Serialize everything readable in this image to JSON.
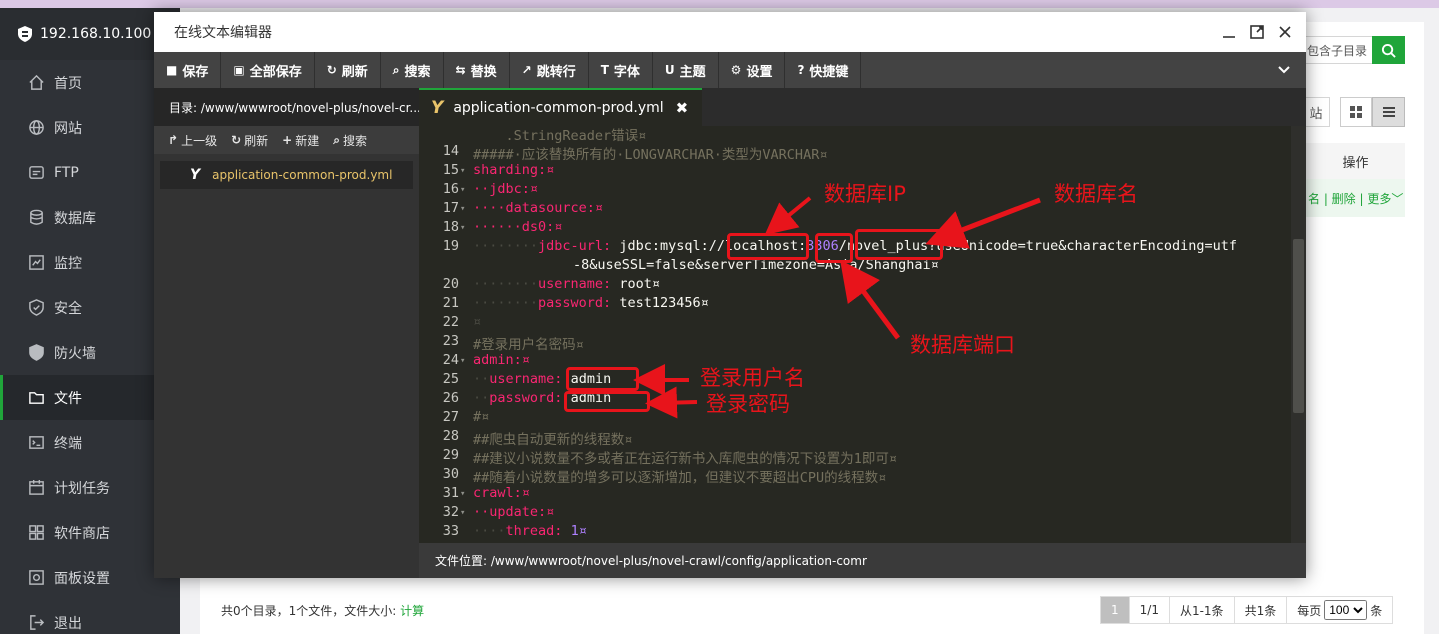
{
  "sidebar": {
    "host": "192.168.10.100",
    "items": [
      {
        "label": "首页",
        "icon": "home-icon"
      },
      {
        "label": "网站",
        "icon": "globe-icon"
      },
      {
        "label": "FTP",
        "icon": "ftp-icon"
      },
      {
        "label": "数据库",
        "icon": "database-icon"
      },
      {
        "label": "监控",
        "icon": "monitor-icon"
      },
      {
        "label": "安全",
        "icon": "shield-icon"
      },
      {
        "label": "防火墙",
        "icon": "firewall-icon"
      },
      {
        "label": "文件",
        "icon": "folder-icon"
      },
      {
        "label": "终端",
        "icon": "terminal-icon"
      },
      {
        "label": "计划任务",
        "icon": "calendar-icon"
      },
      {
        "label": "软件商店",
        "icon": "apps-icon"
      },
      {
        "label": "面板设置",
        "icon": "settings-icon"
      },
      {
        "label": "退出",
        "icon": "logout-icon"
      }
    ],
    "active_index": 7
  },
  "background": {
    "search_placeholder": "包含子目录",
    "site_btn": "站",
    "col_action": "操作",
    "row_actions": "名 | 删除 | 更多",
    "footer_prefix": "共0个目录，1个文件，文件大小: ",
    "footer_calc": "计算",
    "pager": {
      "current": "1",
      "total": "1/1",
      "range": "从1-1条",
      "count": "共1条",
      "per_page_label": "每页",
      "per_page": "100",
      "unit": "条"
    }
  },
  "editor": {
    "title": "在线文本编辑器",
    "toolbar": [
      {
        "label": "保存",
        "icon": "save-icon",
        "glyph": "■"
      },
      {
        "label": "全部保存",
        "icon": "save-all-icon",
        "glyph": "▣"
      },
      {
        "label": "刷新",
        "icon": "refresh-icon",
        "glyph": "↻"
      },
      {
        "label": "搜索",
        "icon": "search-icon",
        "glyph": "⌕"
      },
      {
        "label": "替换",
        "icon": "replace-icon",
        "glyph": "⇆"
      },
      {
        "label": "跳转行",
        "icon": "goto-line-icon",
        "glyph": "↗"
      },
      {
        "label": "字体",
        "icon": "font-icon",
        "glyph": "T"
      },
      {
        "label": "主题",
        "icon": "theme-icon",
        "glyph": "U"
      },
      {
        "label": "设置",
        "icon": "gear-icon",
        "glyph": "⚙"
      },
      {
        "label": "快捷键",
        "icon": "help-icon",
        "glyph": "?"
      }
    ],
    "dir_label": "目录: /www/wwwroot/novel-plus/novel-cr...",
    "dir_tools": [
      {
        "label": "上一级",
        "glyph": "↱"
      },
      {
        "label": "刷新",
        "glyph": "↻"
      },
      {
        "label": "新建",
        "glyph": "+"
      },
      {
        "label": "搜索",
        "glyph": "⌕"
      }
    ],
    "file_name": "application-common-prod.yml",
    "tab_name": "application-common-prod.yml",
    "status": "文件位置: /www/wwwroot/novel-plus/novel-crawl/config/application-comr",
    "code": {
      "partial_line": "    .StringReader错误¤",
      "lines": [
        {
          "n": "14",
          "text": "#####·应该替换所有的·LONGVARCHAR·类型为VARCHAR¤"
        },
        {
          "n": "15",
          "text": "sharding:¤"
        },
        {
          "n": "16",
          "text": "··jdbc:¤"
        },
        {
          "n": "17",
          "text": "····datasource:¤"
        },
        {
          "n": "18",
          "text": "······ds0:¤"
        },
        {
          "n": "19",
          "key": "jdbc-url:",
          "value": "jdbc:mysql://localhost:",
          "port": "3306",
          "rest": "/novel_plus?useUnicode=true&characterEncoding=utf",
          "wrap": "-8&useSSL=false&serverTimezone=Asia/Shanghai¤"
        },
        {
          "n": "20",
          "key": "username:",
          "value": "root¤"
        },
        {
          "n": "21",
          "key": "password:",
          "value": "test123456¤"
        },
        {
          "n": "22",
          "text": "¤"
        },
        {
          "n": "23",
          "text": "#登录用户名密码¤"
        },
        {
          "n": "24",
          "text": "admin:¤"
        },
        {
          "n": "25",
          "key": "username:",
          "value": "admin"
        },
        {
          "n": "26",
          "key": "password:",
          "value": "admin"
        },
        {
          "n": "27",
          "text": "#¤"
        },
        {
          "n": "28",
          "text": "##爬虫自动更新的线程数¤"
        },
        {
          "n": "29",
          "text": "##建议小说数量不多或者正在运行新书入库爬虫的情况下设置为1即可¤"
        },
        {
          "n": "30",
          "text": "##随着小说数量的增多可以逐渐增加，但建议不要超出CPU的线程数¤"
        },
        {
          "n": "31",
          "text": "crawl:¤"
        },
        {
          "n": "32",
          "text": "··update:¤"
        },
        {
          "n": "33",
          "key": "thread:",
          "value": "1¤"
        }
      ]
    }
  },
  "annotations": {
    "db_ip": "数据库IP",
    "db_name": "数据库名",
    "db_port": "数据库端口",
    "login_user": "登录用户名",
    "login_pass": "登录密码",
    "color": "#e8141b"
  }
}
